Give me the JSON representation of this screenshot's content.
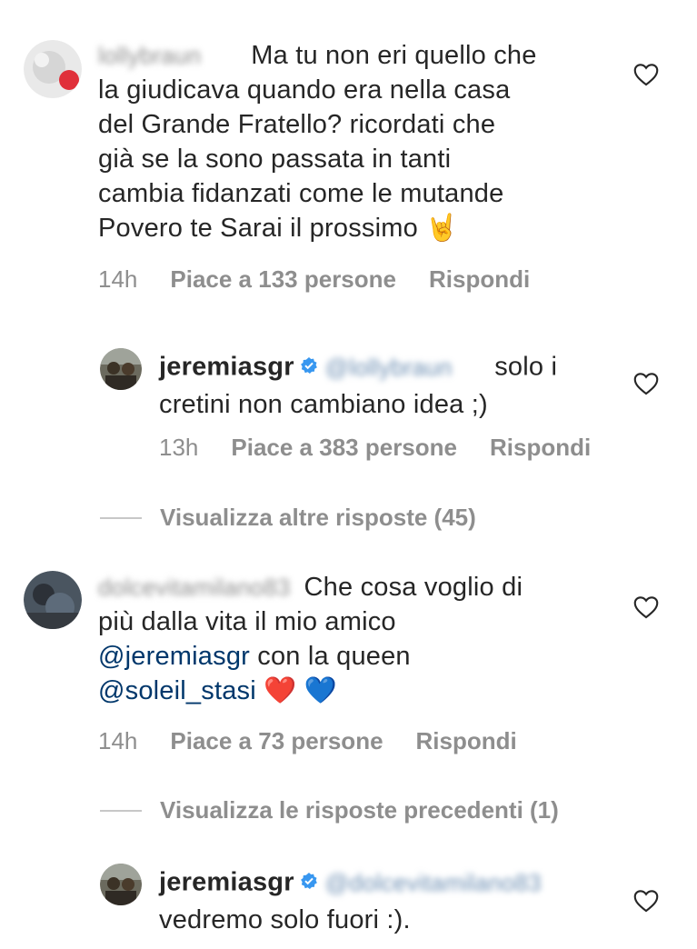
{
  "comments": [
    {
      "username": "lollybraun",
      "text": "Ma tu non eri quello che la giudicava quando era nella casa del Grande Fratello? ricordati che già se la sono passata in tanti cambia fidanzati come le mutande Povero te Sarai il prossimo",
      "line1": "Ma tu non eri quello che",
      "line2": "la giudicava quando era nella casa",
      "line3": "del Grande Fratello? ricordati che",
      "line4": "già se la sono passata in tanti",
      "line5": "cambia fidanzati come le mutande",
      "line6": "Povero te Sarai il prossimo",
      "emoji": "🤘",
      "time": "14h",
      "likes": "Piace a 133 persone",
      "reply": "Rispondi"
    },
    {
      "username": "jeremiasgr",
      "mention": "@lollybraun",
      "line1": "solo i",
      "line2": "cretini non cambiano idea ;)",
      "time": "13h",
      "likes": "Piace a 383 persone",
      "reply": "Rispondi"
    },
    {
      "username": "dolcevitamilano83",
      "line1": "Che cosa voglio di",
      "line2": "più dalla vita il mio amico",
      "mention1": "@jeremiasgr",
      "line3": "con la queen",
      "mention2": "@soleil_stasi",
      "emoji1": "❤️",
      "emoji2": "💙",
      "time": "14h",
      "likes": "Piace a 73 persone",
      "reply": "Rispondi"
    },
    {
      "username": "jeremiasgr",
      "mention": "@dolcevitamilano83",
      "line1": "vedremo solo fuori :)."
    }
  ],
  "view_more_1": "Visualizza altre risposte (45)",
  "view_more_2": "Visualizza le risposte precedenti (1)",
  "icons": {
    "like": "heart-icon",
    "verified": "verified-badge-icon"
  },
  "colors": {
    "text": "#262626",
    "meta": "#8e8e8e",
    "mention": "#00376b",
    "verified": "#3897f0"
  }
}
